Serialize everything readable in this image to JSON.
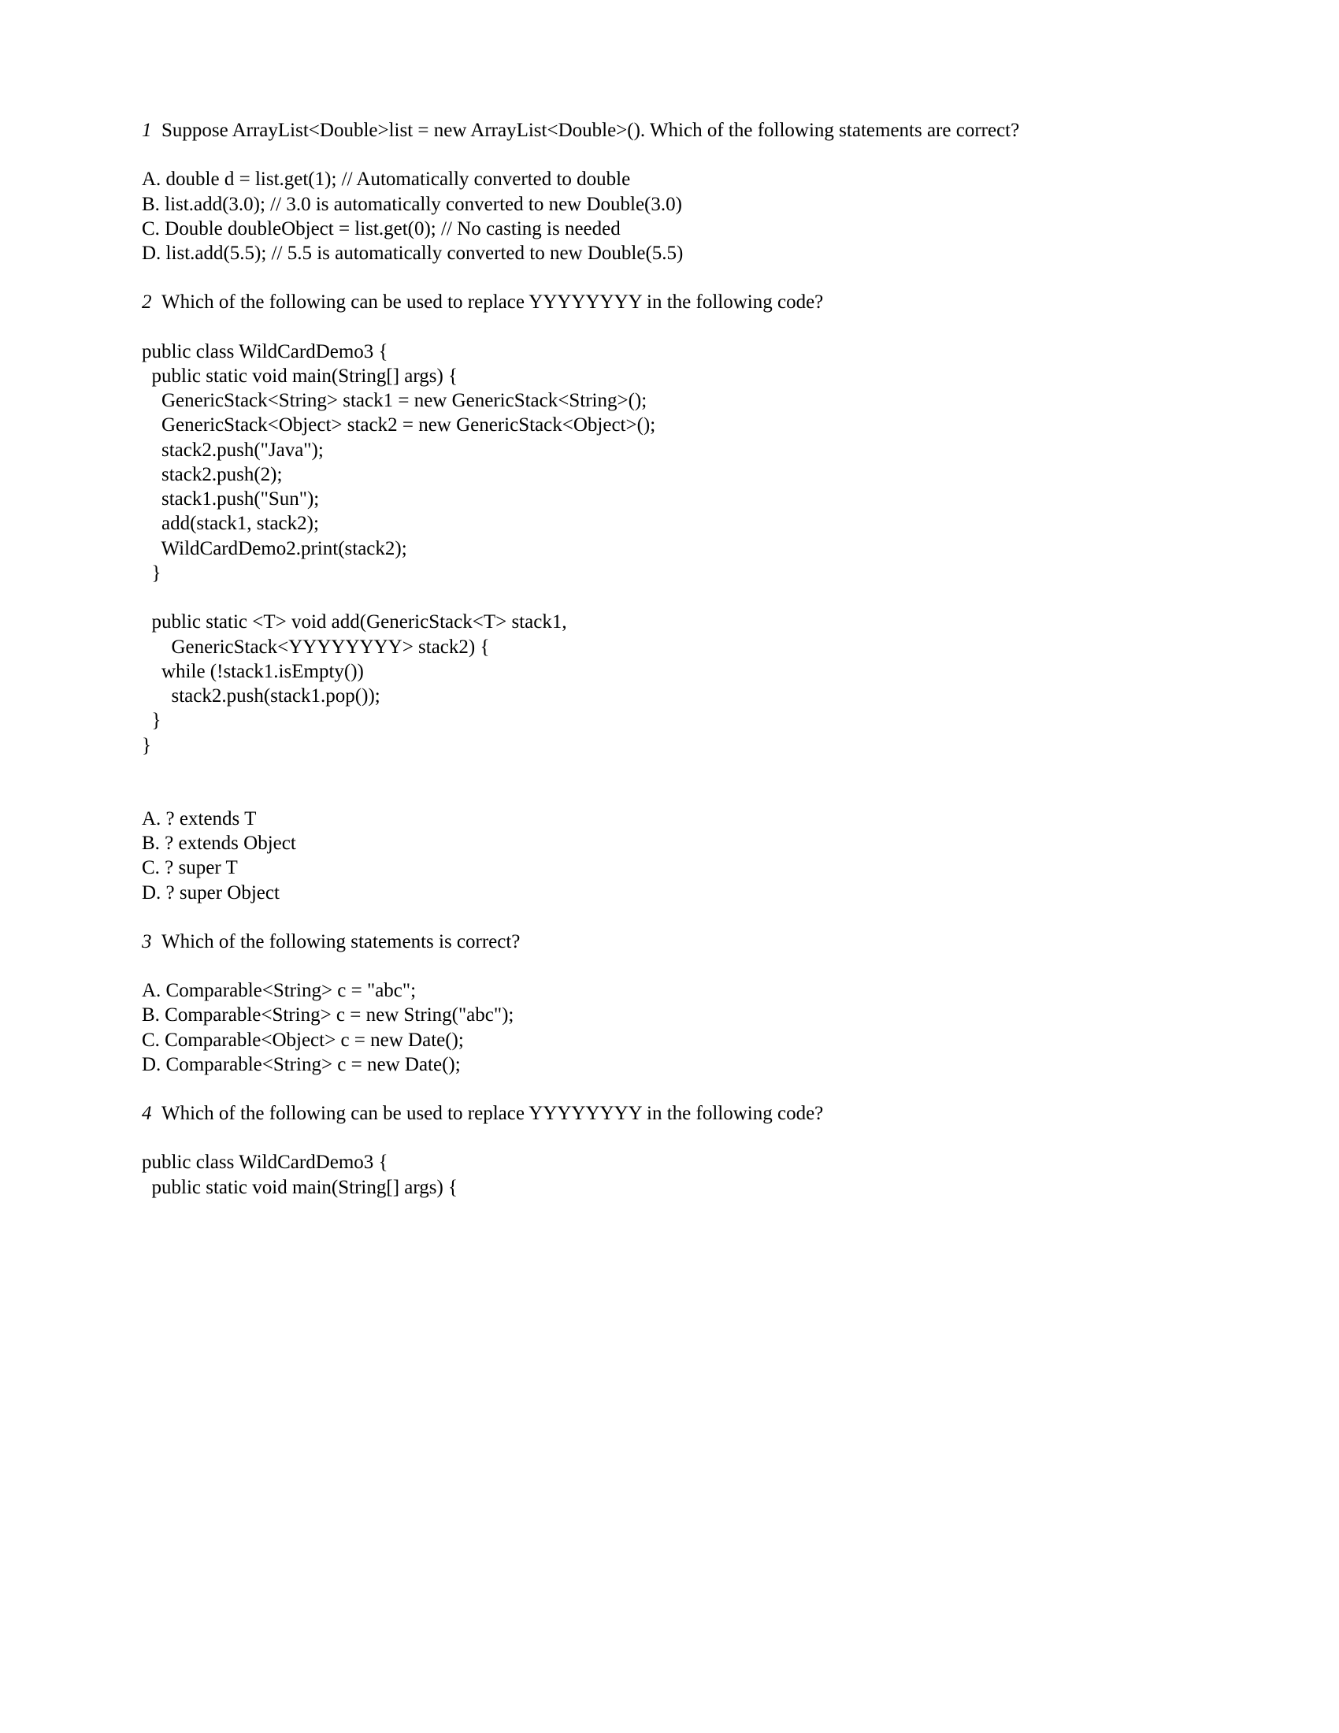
{
  "q1": {
    "num": "1",
    "text": "Suppose ArrayList<Double>list = new ArrayList<Double>(). Which of the following statements are correct?",
    "options": [
      "A. double d = list.get(1); // Automatically converted to double",
      "B. list.add(3.0); // 3.0 is automatically converted to new Double(3.0)",
      "C. Double doubleObject = list.get(0); // No casting is needed",
      "D. list.add(5.5); // 5.5 is automatically converted to new Double(5.5)"
    ]
  },
  "q2": {
    "num": "2",
    "text": "Which of the following can be used to replace YYYYYYYY in the following code?",
    "code": "public class WildCardDemo3 {\n  public static void main(String[] args) {\n    GenericStack<String> stack1 = new GenericStack<String>();\n    GenericStack<Object> stack2 = new GenericStack<Object>();\n    stack2.push(\"Java\");\n    stack2.push(2);\n    stack1.push(\"Sun\");\n    add(stack1, stack2);\n    WildCardDemo2.print(stack2);\n  }\n\n  public static <T> void add(GenericStack<T> stack1,\n      GenericStack<YYYYYYYY> stack2) {\n    while (!stack1.isEmpty())\n      stack2.push(stack1.pop());\n  }\n}",
    "options": [
      "A. ? extends T",
      "B. ? extends Object",
      "C. ? super T",
      "D. ? super Object"
    ]
  },
  "q3": {
    "num": "3",
    "text": "Which of the following statements is correct?",
    "options": [
      "A. Comparable<String> c = \"abc\";",
      "B. Comparable<String> c = new String(\"abc\");",
      "C. Comparable<Object> c = new Date();",
      "D. Comparable<String> c = new Date();"
    ]
  },
  "q4": {
    "num": "4",
    "text": "Which of the following can be used to replace YYYYYYYY in the following code?",
    "code": "public class WildCardDemo3 {\n  public static void main(String[] args) {"
  }
}
